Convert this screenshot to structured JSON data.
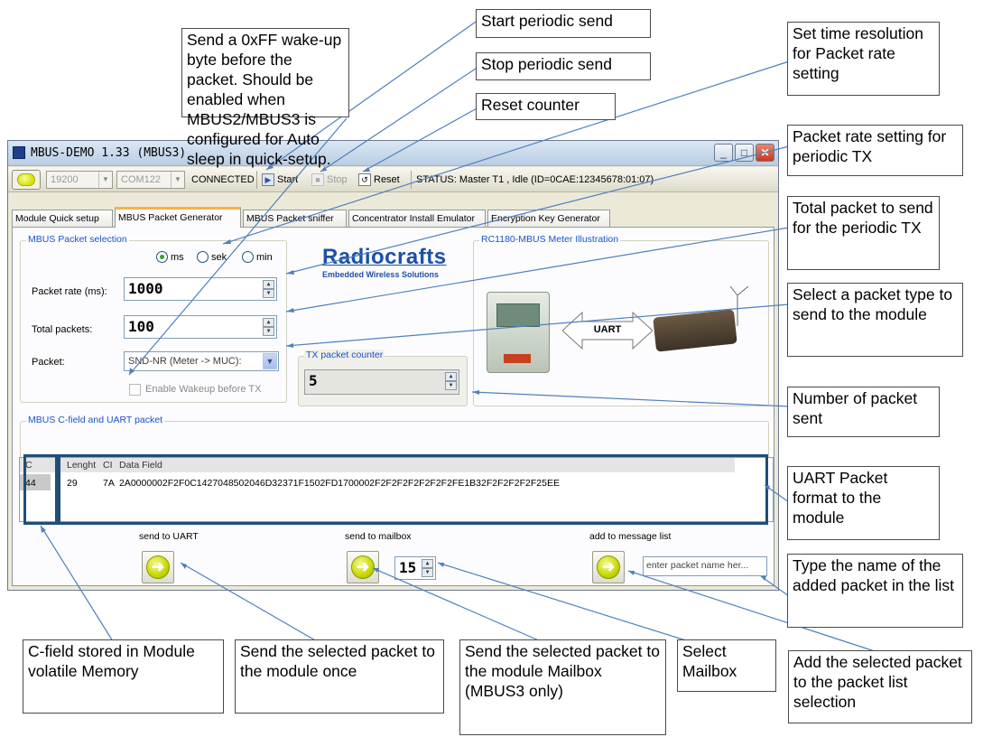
{
  "callouts": {
    "wakeup": "Send a 0xFF wake-up byte before the packet. Should be enabled when MBUS2/MBUS3 is configured for Auto sleep in quick-setup.",
    "start_periodic": "Start periodic send",
    "stop_periodic": "Stop periodic send",
    "reset_counter": "Reset counter",
    "time_resolution": "Set time resolution for Packet rate setting",
    "packet_rate": "Packet rate setting for periodic TX",
    "total_packet": "Total packet to send for the periodic TX",
    "packet_type": "Select a packet type to send to the module",
    "packets_sent": "Number of packet sent",
    "uart_format": "UART Packet format to the module",
    "packet_name": "Type the name of the added packet in the list",
    "cfield": "C-field stored in Module volatile Memory",
    "send_once": "Send the selected packet to the module once",
    "send_mailbox": "Send the selected packet to the module Mailbox (MBUS3 only)",
    "select_mailbox": "Select Mailbox",
    "add_packet": "Add the selected packet to the packet list selection"
  },
  "window": {
    "title": "MBUS-DEMO 1.33 (MBUS3)",
    "minimize": "_",
    "maximize": "□",
    "close": "✕"
  },
  "toolbar": {
    "baud": "19200",
    "port": "COM122",
    "connected": "CONNECTED",
    "start": "Start",
    "stop": "Stop",
    "reset": "Reset",
    "status": "STATUS: Master T1 , Idle  (ID=0CAE:12345678:01:07)"
  },
  "tabs": [
    "Module Quick setup",
    "MBUS Packet Generator",
    "MBUS Packet sniffer",
    "Concentrator Install Emulator",
    "Encryption Key Generator"
  ],
  "packet_selection": {
    "legend": "MBUS Packet  selection",
    "radios": [
      "ms",
      "sek",
      "min"
    ],
    "selected_radio": "ms",
    "rate_label": "Packet rate (ms):",
    "rate_value": "1000",
    "total_label": "Total packets:",
    "total_value": "100",
    "packet_label": "Packet:",
    "packet_value": "SND-NR (Meter -> MUC):",
    "wakeup_label": "Enable Wakeup before TX",
    "wakeup_checked": false
  },
  "logo": {
    "name": "Radiocrafts",
    "tagline": "Embedded Wireless Solutions"
  },
  "tx_counter": {
    "legend": "TX packet counter",
    "value": "5"
  },
  "illustration": {
    "legend": "RC1180-MBUS Meter Illustration",
    "arrow_label": "UART"
  },
  "cfield_group": {
    "legend": "MBUS C-field and UART packet",
    "headers": [
      "C",
      "Lenght",
      "CI",
      "Data Field"
    ],
    "row": [
      "44",
      "29",
      "7A",
      "2A0000002F2F0C1427048502046D32371F1502FD1700002F2F2F2F2F2F2F2FE1B32F2F2F2F2F25EE"
    ]
  },
  "actions": {
    "send_uart": "send to UART",
    "send_mailbox": "send to mailbox",
    "mailbox_value": "15",
    "add_list": "add to message list",
    "name_placeholder": "enter packet name her..."
  },
  "colors": {
    "accent_tab": "#f7b04a",
    "legend_text": "#1a53c8",
    "callout_line": "#4f81bd",
    "highlight_box": "#1f4e79"
  }
}
